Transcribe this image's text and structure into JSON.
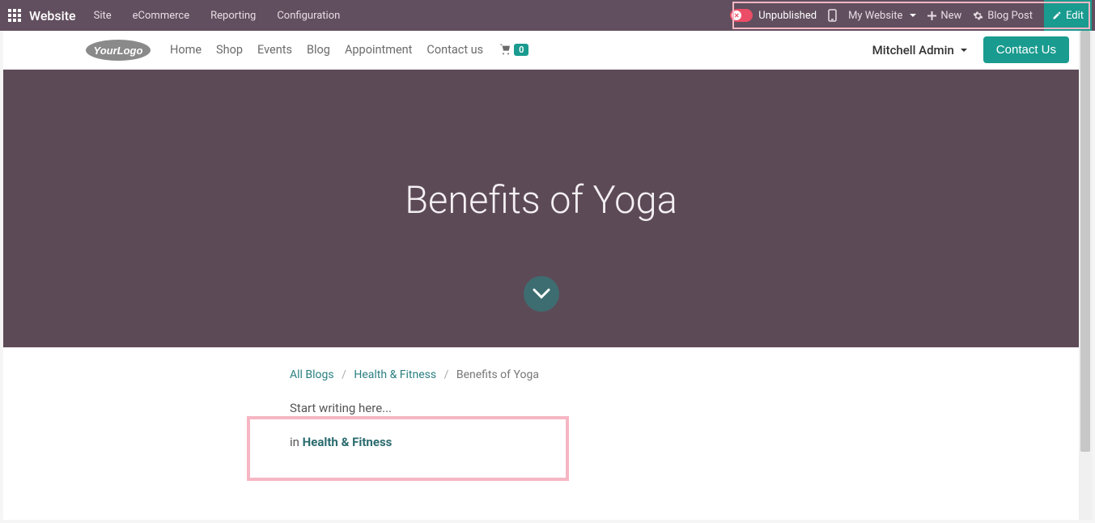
{
  "colors": {
    "topbar": "#614e5e",
    "accent": "#1a9b8f",
    "hero": "#5d4a57",
    "highlight": "#f6b6c3",
    "toggle_off": "#eb4d66"
  },
  "topbar": {
    "brand": "Website",
    "menu": [
      "Site",
      "eCommerce",
      "Reporting",
      "Configuration"
    ],
    "unpublished_label": "Unpublished",
    "my_website_label": "My Website",
    "new_label": "New",
    "blog_post_label": "Blog Post",
    "edit_label": "Edit"
  },
  "site_nav": {
    "logo_text": "YourLogo",
    "links": [
      "Home",
      "Shop",
      "Events",
      "Blog",
      "Appointment",
      "Contact us"
    ],
    "cart_count": "0",
    "user_name": "Mitchell Admin",
    "contact_us": "Contact Us"
  },
  "hero": {
    "title": "Benefits of Yoga"
  },
  "breadcrumb": {
    "all_blogs": "All Blogs",
    "category": "Health & Fitness",
    "current": "Benefits of Yoga",
    "sep": "/"
  },
  "body": {
    "placeholder": "Start writing here...",
    "in_label": "in",
    "category": "Health & Fitness"
  }
}
